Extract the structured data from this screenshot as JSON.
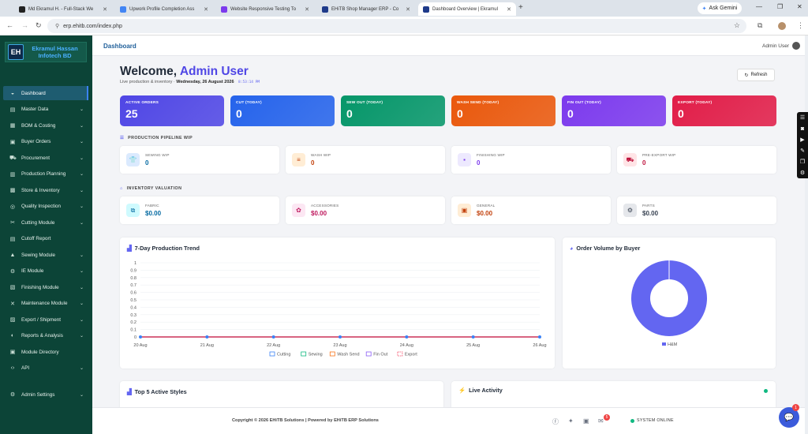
{
  "browser": {
    "tabs": [
      {
        "title": "Md Ekramul H. - Full-Stack We",
        "color": "#222"
      },
      {
        "title": "Upwork Profile Completion Ass",
        "color": "#4285f4"
      },
      {
        "title": "Website Responsive Testing To",
        "color": "#7c3aed"
      },
      {
        "title": "EHiTB Shop Manager ERP - Co",
        "color": "#1e3a8a"
      },
      {
        "title": "Dashboard Overview | Ekramul",
        "color": "#1e3a8a"
      }
    ],
    "new_tab": "+",
    "gemini": "Ask Gemini",
    "url": "erp.ehitb.com/index.php"
  },
  "sidebar": {
    "logo_mark": "EH",
    "brand_line1": "Ekramul Hassan",
    "brand_line2": "Infotech BD",
    "items": [
      {
        "label": "Dashboard",
        "icon": "◒",
        "chev": ""
      },
      {
        "label": "Master Data",
        "icon": "▤",
        "chev": "⌄"
      },
      {
        "label": "BOM & Costing",
        "icon": "▦",
        "chev": "⌄"
      },
      {
        "label": "Buyer Orders",
        "icon": "▣",
        "chev": "⌄"
      },
      {
        "label": "Procurement",
        "icon": "⛟",
        "chev": "⌄"
      },
      {
        "label": "Production Planning",
        "icon": "▥",
        "chev": "⌄"
      },
      {
        "label": "Store & Inventory",
        "icon": "▩",
        "chev": "⌄"
      },
      {
        "label": "Quality Inspection",
        "icon": "◎",
        "chev": "⌄"
      },
      {
        "label": "Cutting Module",
        "icon": "✂",
        "chev": "⌄"
      },
      {
        "label": "Cutoff Report",
        "icon": "▤",
        "chev": ""
      },
      {
        "label": "Sewing Module",
        "icon": "▲",
        "chev": "⌄"
      },
      {
        "label": "IE Module",
        "icon": "⚙",
        "chev": "⌄"
      },
      {
        "label": "Finishing Module",
        "icon": "▧",
        "chev": "⌄"
      },
      {
        "label": "Maintenance Module",
        "icon": "✕",
        "chev": "⌄"
      },
      {
        "label": "Export / Shipment",
        "icon": "▨",
        "chev": "⌄"
      },
      {
        "label": "Reports & Analysis",
        "icon": "◐",
        "chev": "⌄"
      },
      {
        "label": "Module Directory",
        "icon": "▣",
        "chev": ""
      },
      {
        "label": "API",
        "icon": "‹›",
        "chev": "⌄"
      }
    ],
    "admin": {
      "label": "Admin Settings",
      "icon": "⚙",
      "chev": "⌄"
    }
  },
  "header": {
    "breadcrumb": "Dashboard",
    "user": "Admin User"
  },
  "welcome": {
    "prefix": "Welcome,",
    "name": "Admin User",
    "sub": "Live production & inventory ·",
    "date": "Wednesday, 26 August 2026",
    "time": "8:53:14 PM",
    "refresh": "Refresh"
  },
  "stats": [
    {
      "label": "ACTIVE ORDERS",
      "value": "25",
      "color": "#4f46e5"
    },
    {
      "label": "CUT (TODAY)",
      "value": "0",
      "color": "#2563eb"
    },
    {
      "label": "SEW OUT (TODAY)",
      "value": "0",
      "color": "#059669"
    },
    {
      "label": "WASH SEND (TODAY)",
      "value": "0",
      "color": "#ea580c"
    },
    {
      "label": "FIN OUT (TODAY)",
      "value": "0",
      "color": "#7c3aed"
    },
    {
      "label": "EXPORT (TODAY)",
      "value": "0",
      "color": "#e11d48"
    }
  ],
  "pipeline": {
    "title": "PRODUCTION PIPELINE WIP",
    "items": [
      {
        "label": "SEWING WIP",
        "value": "0",
        "icon": "👕",
        "color": "#0369a1",
        "bg": "#dbeafe"
      },
      {
        "label": "WASH WIP",
        "value": "0",
        "icon": "≡",
        "color": "#c2410c",
        "bg": "#ffedd5"
      },
      {
        "label": "FINISHING WIP",
        "value": "0",
        "icon": "▪",
        "color": "#7c3aed",
        "bg": "#ede9fe"
      },
      {
        "label": "PRE-EXPORT WIP",
        "value": "0",
        "icon": "⛟",
        "color": "#be123c",
        "bg": "#ffe4e6"
      }
    ]
  },
  "inventory": {
    "title": "INVENTORY VALUATION",
    "items": [
      {
        "label": "FABRIC",
        "value": "$0.00",
        "icon": "⧉",
        "color": "#0369a1",
        "bg": "#cffafe"
      },
      {
        "label": "ACCESSORIES",
        "value": "$0.00",
        "icon": "✿",
        "color": "#be185d",
        "bg": "#fce7f3"
      },
      {
        "label": "GENERAL",
        "value": "$0.00",
        "icon": "▣",
        "color": "#c2410c",
        "bg": "#ffedd5"
      },
      {
        "label": "PARTS",
        "value": "$0.00",
        "icon": "⚙",
        "color": "#374151",
        "bg": "#e5e7eb"
      }
    ]
  },
  "chart_data": [
    {
      "type": "line",
      "title": "7-Day Production Trend",
      "x": [
        "20 Aug",
        "21 Aug",
        "22 Aug",
        "23 Aug",
        "24 Aug",
        "25 Aug",
        "26 Aug"
      ],
      "yticks": [
        "0",
        "0.1",
        "0.2",
        "0.3",
        "0.4",
        "0.5",
        "0.6",
        "0.7",
        "0.8",
        "0.9",
        "1"
      ],
      "ylim": [
        0,
        1
      ],
      "series": [
        {
          "name": "Cutting",
          "values": [
            0,
            0,
            0,
            0,
            0,
            0,
            0
          ],
          "color": "#3b82f6"
        },
        {
          "name": "Sewing",
          "values": [
            0,
            0,
            0,
            0,
            0,
            0,
            0
          ],
          "color": "#10b981"
        },
        {
          "name": "Wash Send",
          "values": [
            0,
            0,
            0,
            0,
            0,
            0,
            0
          ],
          "color": "#f97316"
        },
        {
          "name": "Fin Out",
          "values": [
            0,
            0,
            0,
            0,
            0,
            0,
            0
          ],
          "color": "#8b5cf6"
        },
        {
          "name": "Export",
          "values": [
            0,
            0,
            0,
            0,
            0,
            0,
            0
          ],
          "color": "#f43f5e"
        }
      ],
      "legend": "bottom"
    },
    {
      "type": "pie",
      "title": "Order Volume by Buyer",
      "categories": [
        "H&M"
      ],
      "values": [
        100
      ],
      "colors": [
        "#6366f1"
      ],
      "legend": "bottom"
    }
  ],
  "styles_card": {
    "title": "Top 5 Active Styles"
  },
  "activity_card": {
    "title": "Live Activity"
  },
  "footer": {
    "copyright": "Copyright © 2026 EHiTB Solutions | Powered by EHiTB ERP Solutions",
    "status": "SYSTEM ONLINE",
    "notif_count": "5"
  },
  "chat_badge": "1"
}
